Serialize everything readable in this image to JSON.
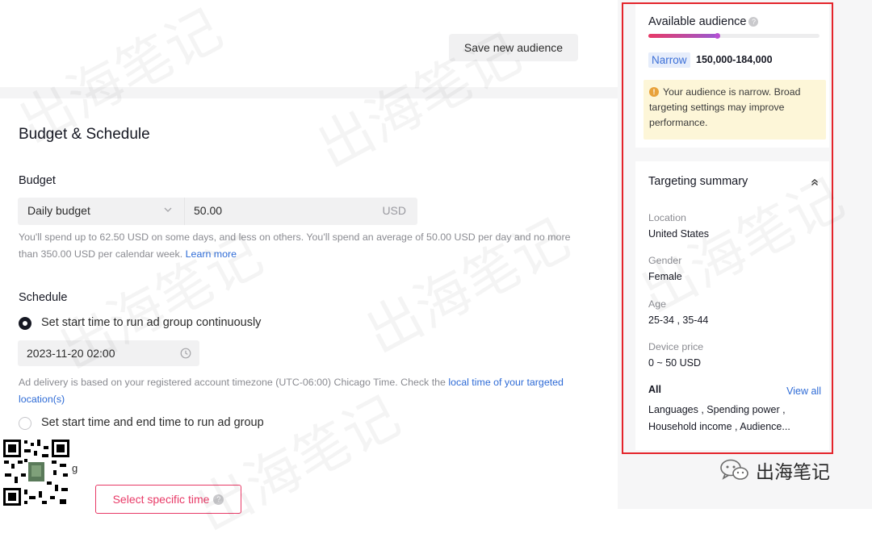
{
  "header": {
    "save_audience_label": "Save new audience"
  },
  "budget_schedule": {
    "title": "Budget & Schedule",
    "budget": {
      "label": "Budget",
      "type": "Daily budget",
      "amount": "50.00",
      "currency": "USD",
      "helper": "You'll spend up to 62.50 USD on some days, and less on others. You'll spend an average of 50.00 USD per day and no more than 350.00 USD per calendar week.",
      "learn_more": "Learn more"
    },
    "schedule": {
      "label": "Schedule",
      "option_continuous": "Set start time to run ad group continuously",
      "start_datetime": "2023-11-20 02:00",
      "timezone_note": "Ad delivery is based on your registered account timezone (UTC-06:00) Chicago Time. Check the",
      "timezone_link": "local time of your targeted location(s)",
      "option_start_end": "Set start time and end time to run ad group",
      "partial_letter": "g",
      "select_time_label": "Select specific time"
    }
  },
  "audience": {
    "title": "Available audience",
    "meter_fraction": 0.4,
    "size_badge": "Narrow",
    "range": "150,000-184,000",
    "warning": "Your audience is narrow. Broad targeting settings may improve performance.",
    "colors": {
      "badge_bg": "#e6edfb",
      "badge_text": "#3b6fd7",
      "warning_bg": "#fdf6d8",
      "accent": "#e83a67"
    }
  },
  "targeting_summary": {
    "title": "Targeting summary",
    "items": [
      {
        "label": "Location",
        "value": "United States"
      },
      {
        "label": "Gender",
        "value": "Female"
      },
      {
        "label": "Age",
        "value": "25-34 , 35-44"
      },
      {
        "label": "Device price",
        "value": "0 ~ 50 USD"
      }
    ],
    "all_label": "All",
    "view_all": "View all",
    "all_line1": "Languages , Spending power ,",
    "all_line2": "Household income , Audience..."
  },
  "branding": {
    "text": "出海笔记",
    "watermark": "出海笔记"
  },
  "icons": [
    "chevron-down-icon",
    "clock-icon",
    "info-icon",
    "warning-icon",
    "collapse-icon",
    "wechat-icon",
    "qr-code"
  ]
}
